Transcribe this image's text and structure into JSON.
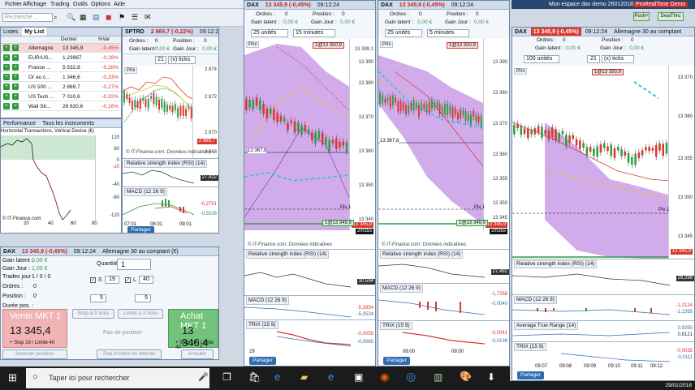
{
  "topbar": {
    "app_title": "Mon espace dax demo 26012018",
    "brand": "ProRealTime Demo",
    "search_placeholder": "Recherche ...",
    "push": "Push+",
    "dealthru": "DealThru"
  },
  "menu": [
    "Fichier",
    "Affichage",
    "Trading",
    "Outils",
    "Options",
    "Aide"
  ],
  "watchlist": {
    "tab_lists": "Listes",
    "tab_mylist": "My List",
    "col_last": "Dernier",
    "col_var": "%Var",
    "rows": [
      {
        "name": "Allemagne",
        "last": "13 345,9",
        "var": "-0,45%"
      },
      {
        "name": "EUR/US...",
        "last": "1,23967",
        "var": "-0,28%"
      },
      {
        "name": "France ...",
        "last": "5 532,8",
        "var": "-0,28%"
      },
      {
        "name": "Or au c...",
        "last": "1 346,6",
        "var": "-0,33%"
      },
      {
        "name": "US 500 ...",
        "last": "2 869,7",
        "var": "-0,27%"
      },
      {
        "name": "US Tech ...",
        "last": "7 010,6",
        "var": "-0,32%"
      },
      {
        "name": "Wall Str...",
        "last": "26 630,6",
        "var": "-0,16%"
      }
    ]
  },
  "performance": {
    "title": "Performance",
    "subtitle": "Tous les instruments",
    "subtab": "Horizontal Transactions, Vertical Devise (€)",
    "y_ticks": [
      "120",
      "60",
      "0",
      "-10",
      "-40",
      "-60",
      "-120"
    ],
    "x_ticks": [
      "20",
      "40",
      "60",
      "80"
    ],
    "footer": "© IT-Finance.com"
  },
  "spx": {
    "header": "SPTRD",
    "price": "2 869,7 (-0,22%)",
    "time": "09:12:24",
    "ordres": "Ordres :",
    "ordres_val": "0",
    "position": "Position :",
    "position_val": "0",
    "gain_latent": "Gain latent :",
    "gain_latent_val": "0,00 €",
    "gain_jour": "Gain Jour :",
    "gain_jour_val": "0,00 €",
    "ticks_value": "21",
    "ticks_unit": "(x) ticks",
    "prix_tab": "Prix",
    "y_ticks": [
      "2 874",
      "2 872",
      "2 870",
      "2 868"
    ],
    "price_tag": "2 869,7",
    "x_ticks": [
      "07:01",
      "08:01",
      "09:01"
    ],
    "watermark": "© IT-Finance.com: Données indicatives",
    "rsi": "Relative strength index (RSI) (14)",
    "rsi_val": "27,422",
    "macd": "MACD (12 26 9)",
    "macd_vals": [
      "-0,2791",
      "-0,5536"
    ],
    "partager": "Partager"
  },
  "dax15": {
    "header": "DAX",
    "price": "13 345,9 (-0,45%)",
    "time": "09:12:24",
    "ordres": "Ordres :",
    "ordres_val": "0",
    "position": "Position :",
    "position_val": "0",
    "gain_latent": "Gain latent :",
    "gain_latent_val": "0,00 €",
    "gain_jour": "Gain Jour :",
    "gain_jour_val": "0,00 €",
    "units": "25 unités",
    "period": "15 minutes",
    "prix_tab": "Prix",
    "label_top": "1@13 350,9",
    "y_ticks": [
      "13 399,1",
      "13 390",
      "13 380",
      "13 370",
      "13 360",
      "13 350",
      "13 340"
    ],
    "price_tag": "13 345,9",
    "pivot": "Piv 1",
    "tag_35": "2m35s",
    "mark_hi": "13 367,8",
    "bottom_tag": "1@13 349,9",
    "watermark": "© IT-Finance.com: Données indicatives",
    "rsi": "Relative strength index (RSI) (14)",
    "rsi_val": "30,594",
    "macd": "MACD (12 26 9)",
    "macd_vals": [
      "-5,3954",
      "-5,0524"
    ],
    "trix": "TRIX (15 9)",
    "trix_vals": [
      "-0,0055",
      "-0,0085"
    ],
    "x_ticks": [
      "29"
    ],
    "partager": "Partager"
  },
  "dax5": {
    "header": "DAX",
    "price": "13 345,9 (-0,45%)",
    "time": "09:12:24",
    "ordres": "Ordres :",
    "ordres_val": "0",
    "position": "Position :",
    "position_val": "0",
    "gain_latent": "Gain latent :",
    "gain_latent_val": "0,00 €",
    "gain_jour": "Gain Jour :",
    "gain_jour_val": "0,00 €",
    "units": "25 unités",
    "period": "5 minutes",
    "prix_tab": "Prix",
    "label_top": "1@13 350,9",
    "y_ticks": [
      "13 390",
      "13 380",
      "13 370",
      "13 360",
      "13 355",
      "13 350",
      "13 345"
    ],
    "price_tag": "13 345,9",
    "pivot": "Piv 1",
    "tag_35": "2m35s",
    "mark_hi": "13 367,8",
    "bottom_tag": "1@13 349,9",
    "watermark": "© IT-Finance.com: Données indicatives",
    "rsi": "Relative strength index (RSI) (14)",
    "rsi_val": "27,492",
    "macd": "MACD (12 26 9)",
    "macd_vals": [
      "-1,7358",
      "-0,0040"
    ],
    "trix": "TRIX (15 9)",
    "trix_vals": [
      "-0,0041",
      "-0,0136"
    ],
    "x_ticks": [
      "08:00",
      "09:00"
    ],
    "partager": "Partager"
  },
  "dax1": {
    "header": "DAX",
    "price": "13 345,9 (-0,45%)",
    "time": "09:12:24",
    "subtitle": "Allemagne 30 au comptant",
    "ordres": "Ordres :",
    "ordres_val": "0",
    "position": "Position :",
    "position_val": "0",
    "gain_latent": "Gain latent :",
    "gain_latent_val": "0,00 €",
    "gain_jour": "Gain Jour :",
    "gain_jour_val": "0,00 €",
    "units": "100 unités",
    "ticks_value": "21",
    "ticks_unit": "(x) ticks",
    "prix_tab": "Prix",
    "label_top": "1@13 350,9",
    "y_ticks": [
      "13 370",
      "13 360",
      "13 355",
      "13 350",
      "13 345"
    ],
    "price_tag": "13 345,9",
    "pivot": "Piv 1",
    "rsi": "Relative strength index (RSI) (14)",
    "rsi_val": "28,288",
    "macd": "MACD (12 26 9)",
    "macd_vals": [
      "-1,2124",
      "-1,1355"
    ],
    "atr": "Average True Range (14)",
    "atr_vals": [
      "0,9250",
      "0,8121"
    ],
    "trix": "TRIX (15 9)",
    "trix_vals": [
      "-0,0035",
      "-0,0111"
    ],
    "x_ticks": [
      "09:07",
      "09:08",
      "09:09",
      "09:10",
      "09:11",
      "09:12"
    ],
    "partager": "Partager"
  },
  "order": {
    "header": "DAX",
    "price": "13 345,9 (-0,45%)",
    "time": "09:12:24",
    "subtitle": "Allemagne 30 au comptant (€)",
    "gain_latent": "Gain latent :",
    "gain_latent_val": "0,00 €",
    "gain_jour": "Gain Jour :",
    "gain_jour_val": "1,00 €",
    "trades": "Trades jour :",
    "trades_val": "1 / 0 / 0",
    "ordres": "Ordres :",
    "ordres_val": "0",
    "position": "Position :",
    "position_val": "0",
    "duree": "Durée pos. :",
    "quantite": "Quantité",
    "quantite_val": "1",
    "s_label": "S",
    "s_val": "19",
    "l_label": "L",
    "l_val": "40",
    "five_a": "5",
    "five_b": "5",
    "stop5": "Stop à 5 ticks",
    "limite5": "Limite à 5 ticks",
    "pas_position": "Pas de position",
    "vente_label": "Vente MKT 1",
    "vente_price": "13 345,4",
    "vente_sub": "+ Stop 19 / Limite 40",
    "achat_label": "Achat MKT 1",
    "achat_price": "13 346,4",
    "achat_sub": "+ Stop 19 / Limite 40",
    "inverser": "Inverser position",
    "pas_ordre": "Pas d'ordre en attente",
    "annuler": "Annuler"
  },
  "taskbar": {
    "search": "Taper ici pour rechercher",
    "date": "29/01/2018"
  },
  "colors": {
    "green": "#2f9e44",
    "red": "#d9392e",
    "purple": "#b066d6",
    "accent": "#2f6db3",
    "sell_bg": "#f1b3b3",
    "buy_bg": "#73c27c"
  }
}
